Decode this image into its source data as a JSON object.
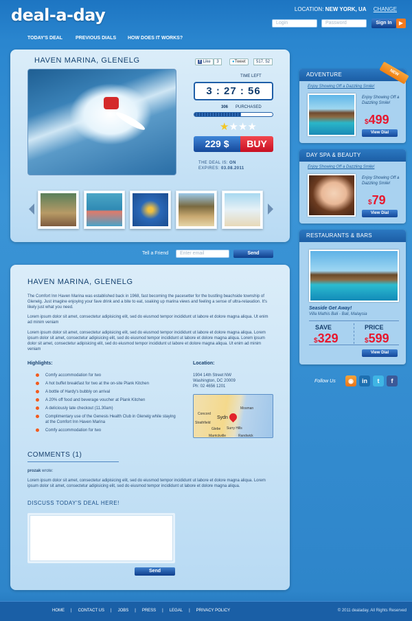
{
  "header": {
    "logo": "deal-a-day",
    "location_label": "LOCATION:",
    "location_value": "NEW YORK, UA",
    "change": "CHANGE",
    "login_placeholder": "Login",
    "password_placeholder": "Password",
    "sign_in": "Sign In"
  },
  "nav": [
    "TODAY'S DEAL",
    "PREVIOUS DIALS",
    "HOW DOES IT WORKS?"
  ],
  "deal": {
    "title": "HAVEN MARINA, GLENELG",
    "like": "Like",
    "like_count": "3",
    "tweet": "Tweet",
    "tweet_count": "517, 52",
    "time_left_label": "TIME LEFT",
    "time_left": "3 : 27 : 56",
    "purchased_count": "306",
    "purchased_label": "PURCHASED",
    "progress": 0.6,
    "rating": "1 of 4",
    "price": "229 $",
    "buy": "BUY",
    "deal_is_label": "THE DEAL IS:",
    "deal_is_value": "ON",
    "expires_label": "EXPIRES:",
    "expires_value": "03.08.2011"
  },
  "tell": {
    "label": "Tell a Friend",
    "placeholder": "Enter email",
    "send": "Send"
  },
  "detail": {
    "title": "HAVEN MARINA, GLENELG",
    "p1": "The Comfort Inn Haven Marina was established back in 1968, fast becoming the pacesetter for the bustling beachside township of Glenelg. Just imagine enjoying your fave drink and a bite to eat, soaking up marina views and feeling a sense of ultra-relaxation. It's likely just what you need.",
    "p2": "Lorem ipsum dolor sit amet, consectetur adipisicing elit, sed do eiusmod tempor incididunt ut labore et dolore magna aliqua. Ut enim ad minim veniam",
    "p3": "Lorem ipsum dolor sit amet, consectetur adipisicing elit, sed do eiusmod tempor incididunt ut labore et dolore magna aliqua. Lorem ipsum dolor sit amet, consectetur adipisicing elit, sed do eiusmod tempor incididunt ut labore et dolore magna aliqua. Lorem ipsum dolor sit amet, consectetur adipisicing elit, sed do eiusmod tempor incididunt ut labore et dolore magna aliqua. Ut enim ad minim veniam",
    "highlights_title": "Highlights:",
    "highlights": [
      "Comfy accommodation for two",
      "A hot buffet breakfast for two at the on-site Plank Kitchen",
      "A bottle of Hardy's bubbly on arrival",
      "A 20% off food and beverage voucher at Plank Kitchen",
      "A deliciously late checkout (11.30am)",
      "Complimentary use of the Genesis Health Club in Glenelg while staying at the Comfort Inn Haven Marina",
      "Comfy accommodation for two"
    ],
    "location_title": "Location:",
    "address1": "1904 14th Street NW",
    "address2": "Washington, DC 20009",
    "phone": "Ph: 02 4656 1201",
    "map_labels": [
      "Sydn",
      "Mosman",
      "Concord",
      "Strathfield",
      "Glebe",
      "Surry Hills",
      "Marrickville",
      "Randwick"
    ],
    "comments_title": "COMMENTS (1)",
    "comment_author": "prozak",
    "comment_wrote": "wrote:",
    "comment_text": "Lorem ipsum dolor sit amet, consectetur adipisicing elit, sed do eiusmod tempor incididunt ut labore et dolore magna aliqua. Lorem ipsum dolor sit amet, consectetur adipisicing elit, sed do eiusmod tempor incididunt ut labore et dolore magna aliqua.",
    "discuss_title": "DISCUSS TODAY'S DEAL HERE!",
    "send": "Send"
  },
  "sidebar": {
    "adventure": {
      "title": "ADVENTURE",
      "badge": "NEW",
      "link": "Enjoy Showing Off a Dazzling Smile!",
      "desc": "Enjoy Showing Off a Dazzling Smile!",
      "currency": "$",
      "price": "499",
      "button": "View Dial"
    },
    "spa": {
      "title": "DAY SPA & BEAUTY",
      "link": "Enjoy Showing Off a Dazzling Smile!",
      "desc": "Enjoy Showing Off a Dazzling Smile!",
      "currency": "$",
      "price": "79",
      "button": "View Dial"
    },
    "restaurants": {
      "title": "RESTAURANTS & BARS",
      "caption": "Seaside Get Away!",
      "subcaption": "Villa Mathis Bali - Bali, Malaysia",
      "save_label": "SAVE",
      "save_currency": "$",
      "save_value": "329",
      "price_label": "PRICE",
      "price_currency": "$",
      "price_value": "599",
      "button": "View Dial"
    },
    "follow": "Follow Us"
  },
  "footer": {
    "links": [
      "HOME",
      "CONTACT US",
      "JOBS",
      "PRESS",
      "LEGAL",
      "PRIVACY POLICY"
    ],
    "copyright": "© 2011 dealaday. All Rights Reserved"
  }
}
